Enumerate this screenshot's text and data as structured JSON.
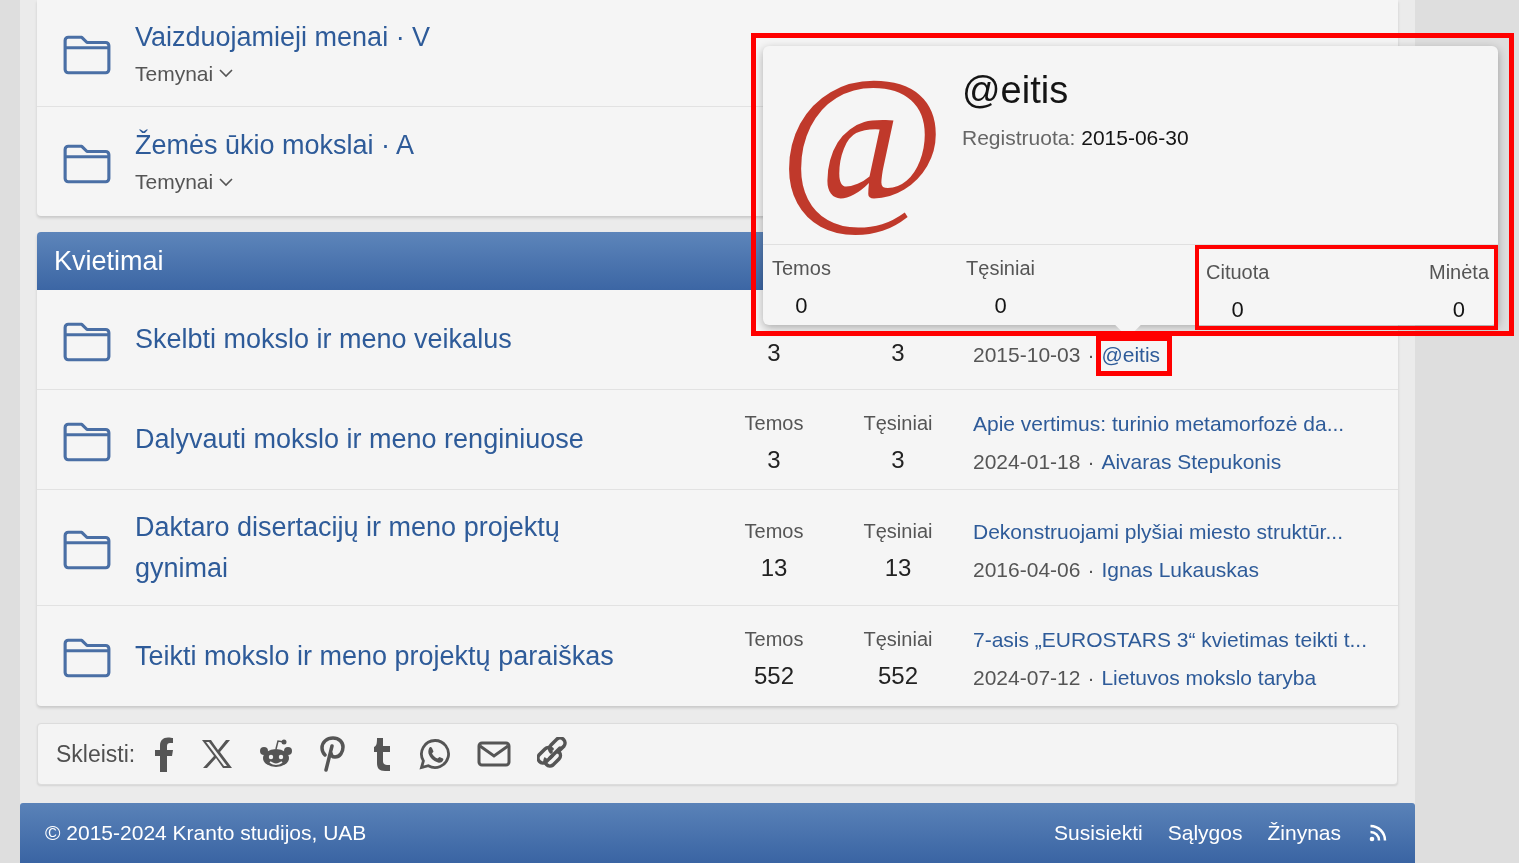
{
  "top_nodes": [
    {
      "title": "Vaizduojamieji menai · V",
      "subforums": "Temynai"
    },
    {
      "title": "Žemės ūkio mokslai · A",
      "subforums": "Temynai"
    }
  ],
  "invitations": {
    "title": "Kvietimai",
    "nodes": [
      {
        "title": "Skelbti mokslo ir meno veikalus",
        "stats": [
          {
            "value": "3"
          },
          {
            "value": "3"
          }
        ],
        "last_post": {
          "date": "2015-10-03",
          "separator": "·",
          "author": "@eitis",
          "author_highlighted": true
        }
      },
      {
        "title": "Dalyvauti mokslo ir meno renginiuose",
        "stats": [
          {
            "label": "Temos",
            "value": "3"
          },
          {
            "label": "Tęsiniai",
            "value": "3"
          }
        ],
        "last_post": {
          "title": "Apie vertimus: turinio metamorfozė da...",
          "date": "2024-01-18",
          "separator": "·",
          "author": "Aivaras Stepukonis"
        }
      },
      {
        "title": "Daktaro disertacijų ir meno projektų gynimai",
        "stats": [
          {
            "label": "Temos",
            "value": "13"
          },
          {
            "label": "Tęsiniai",
            "value": "13"
          }
        ],
        "last_post": {
          "title": "Dekonstruojami plyšiai miesto struktūr...",
          "date": "2016-04-06",
          "separator": "·",
          "author": "Ignas Lukauskas"
        }
      },
      {
        "title": "Teikti mokslo ir meno projektų paraiškas",
        "stats": [
          {
            "label": "Temos",
            "value": "552"
          },
          {
            "label": "Tęsiniai",
            "value": "552"
          }
        ],
        "last_post": {
          "title": "7-asis „EUROSTARS 3“ kvietimas teikti t...",
          "date": "2024-07-12",
          "separator": "·",
          "author": "Lietuvos mokslo taryba"
        }
      }
    ]
  },
  "user_popup": {
    "avatar_glyph": "@",
    "username": "@eitis",
    "registered_label": "Registruota:",
    "registered_date": "2015-06-30",
    "highlighted": true,
    "stat_groups": [
      {
        "stats": [
          {
            "label": "Temos",
            "value": "0"
          },
          {
            "label": "Tęsiniai",
            "value": "0"
          }
        ]
      },
      {
        "highlighted": true,
        "stats": [
          {
            "label": "Cituota",
            "value": "0"
          },
          {
            "label": "Minėta",
            "value": "0"
          }
        ]
      }
    ]
  },
  "share": {
    "label": "Skleisti:",
    "buttons": [
      {
        "kind": "facebook"
      },
      {
        "kind": "x"
      },
      {
        "kind": "reddit"
      },
      {
        "kind": "pinterest"
      },
      {
        "kind": "tumblr"
      },
      {
        "kind": "whatsapp"
      },
      {
        "kind": "email"
      },
      {
        "kind": "link"
      }
    ]
  },
  "footer": {
    "copyright": "© 2015-2024 Kranto studijos, UAB",
    "links": [
      "Susisiekti",
      "Sąlygos",
      "Žinynas"
    ],
    "rss": true
  }
}
